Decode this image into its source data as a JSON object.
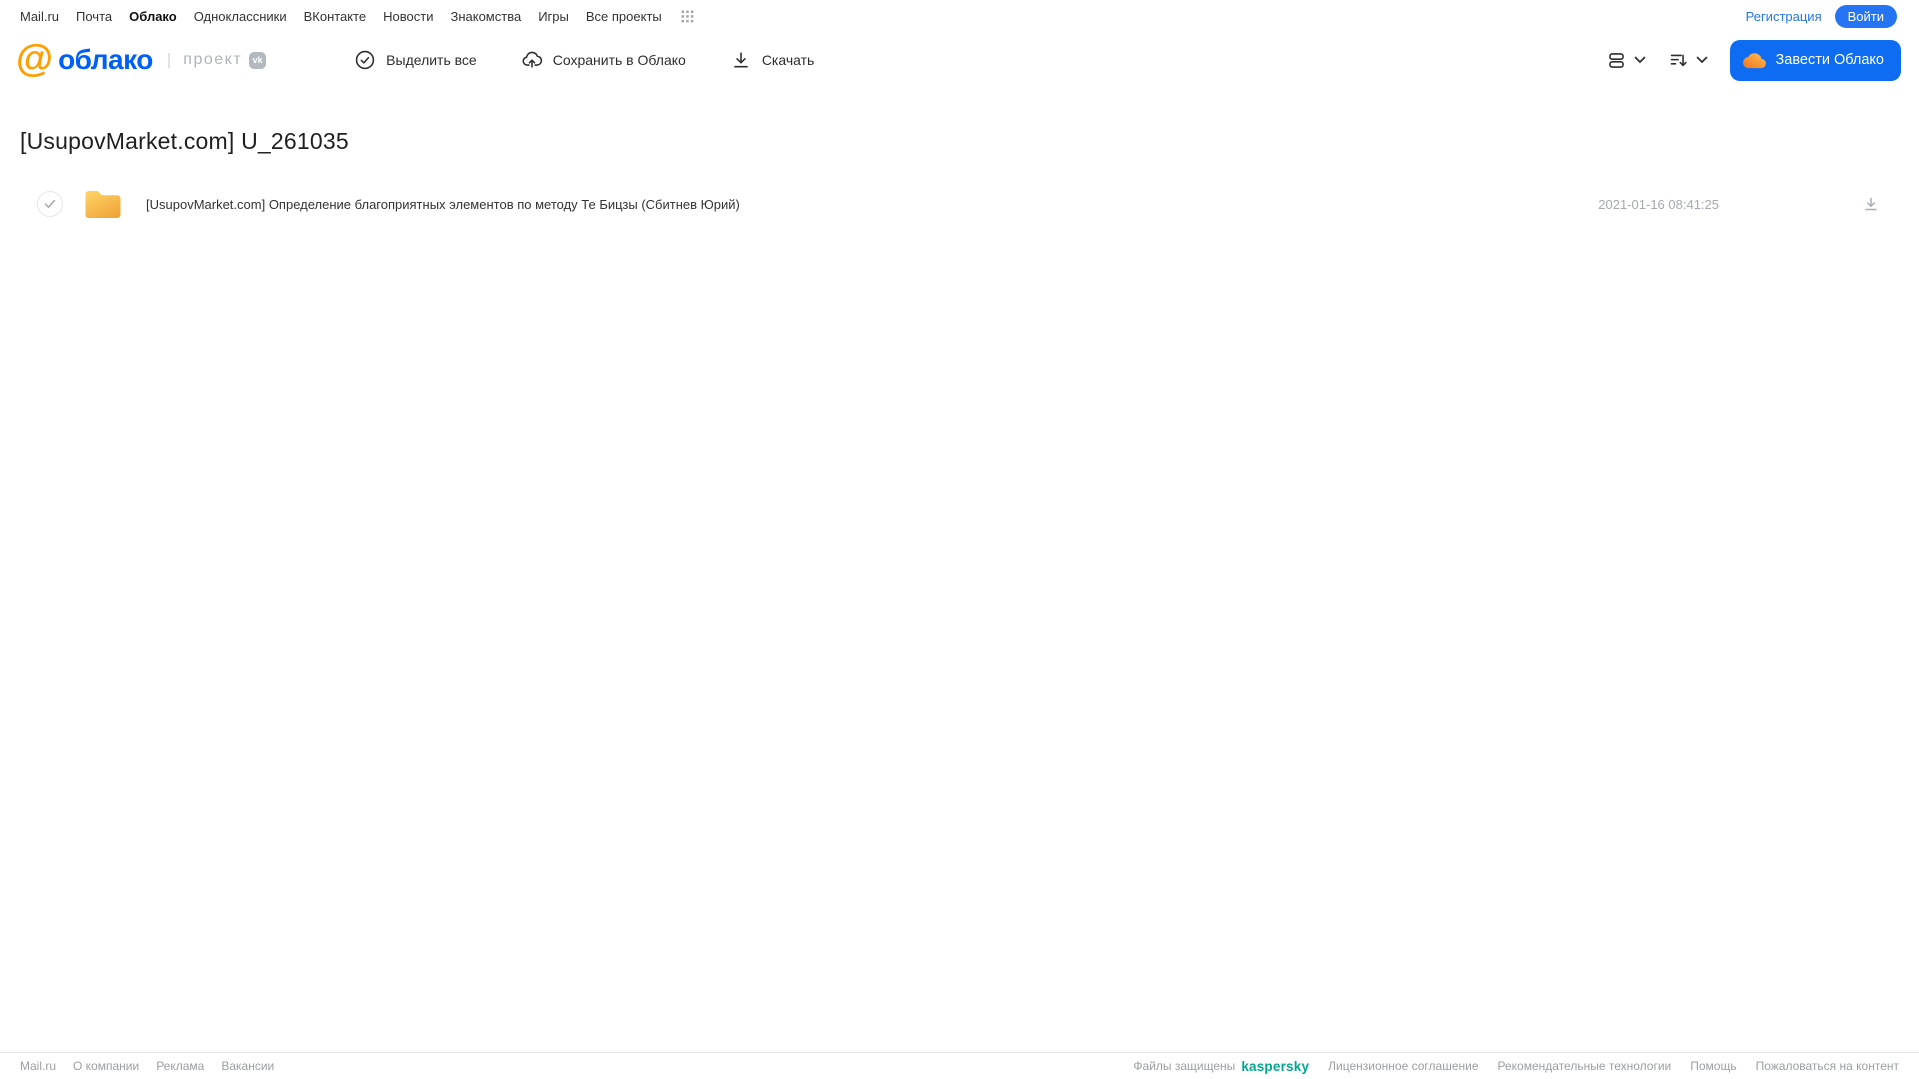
{
  "top_nav": {
    "items": [
      "Mail.ru",
      "Почта",
      "Облако",
      "Одноклассники",
      "ВКонтакте",
      "Новости",
      "Знакомства",
      "Игры",
      "Все проекты"
    ],
    "registration": "Регистрация",
    "login": "Войти"
  },
  "header": {
    "logo": {
      "at": "@",
      "text": "облако",
      "divider": "|",
      "project": "проект",
      "vk_badge": "vk"
    },
    "actions": {
      "select_all": "Выделить все",
      "save_to_cloud": "Сохранить в Облако",
      "download": "Скачать"
    },
    "get_cloud": "Завести Облако"
  },
  "page": {
    "title": "[UsupovMarket.com] U_261035"
  },
  "files": [
    {
      "type": "folder",
      "name": "[UsupovMarket.com] Определение благоприятных элементов по методу Те Бицзы (Сбитнев Юрий)",
      "date": "2021-01-16 08:41:25"
    }
  ],
  "footer": {
    "left_links": [
      "Mail.ru",
      "О компании",
      "Реклама",
      "Вакансии"
    ],
    "protected_label": "Файлы защищены",
    "kaspersky": "kaspersky",
    "right_links": [
      "Лицензионное соглашение",
      "Рекомендательные технологии",
      "Помощь",
      "Пожаловаться на контент"
    ]
  },
  "colors": {
    "accent_blue": "#2574f4",
    "logo_blue": "#005ff9",
    "button_blue": "#0d6cf2",
    "logo_orange": "#ff9e00",
    "kaspersky_teal": "#00a88e",
    "folder_top": "#ffd064",
    "folder_bottom": "#efa538"
  }
}
